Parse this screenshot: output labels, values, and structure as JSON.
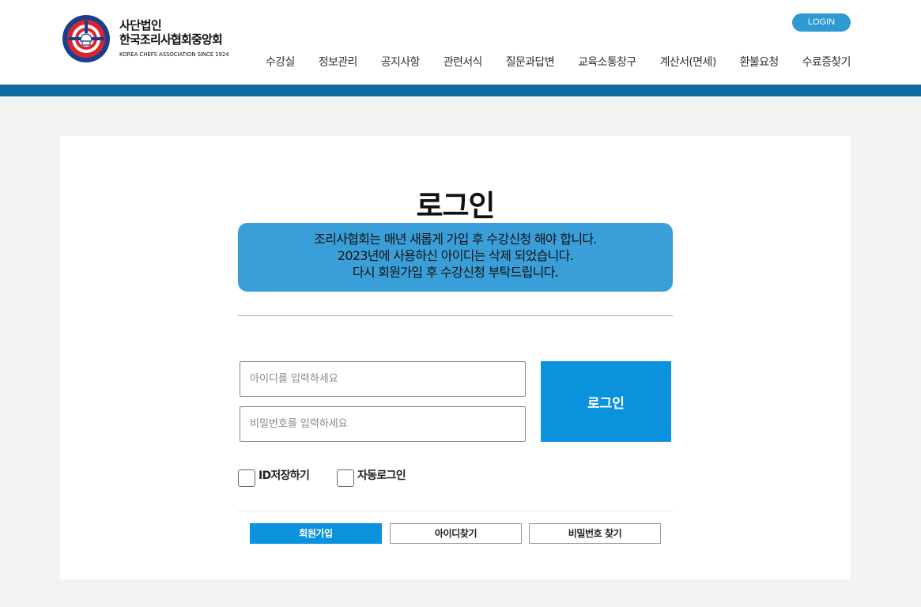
{
  "header": {
    "logo": {
      "line1": "사단법인",
      "line2": "한국조리사협회중앙회",
      "line3": "KOREA CHEFS ASSOCIATION SINCE 1924"
    },
    "login_label": "LOGIN",
    "nav": [
      {
        "label": "수강실"
      },
      {
        "label": "정보관리"
      },
      {
        "label": "공지사항"
      },
      {
        "label": "관련서식"
      },
      {
        "label": "질문과답변"
      },
      {
        "label": "교육소통창구"
      },
      {
        "label": "계산서(면세)"
      },
      {
        "label": "환불요청"
      },
      {
        "label": "수료증찾기"
      }
    ]
  },
  "login": {
    "title": "로그인",
    "notice": [
      "조리사협회는 매년 새롭게 가입 후 수강신청 해야 합니다.",
      "2023년에 사용하신 아이디는 삭제 되었습니다.",
      "다시 회원가입 후 수강신청 부탁드립니다."
    ],
    "id_placeholder": "아이디를 입력하세요",
    "pw_placeholder": "비밀번호를 입력하세요",
    "submit_label": "로그인",
    "save_id_label": "ID저장하기",
    "auto_login_label": "자동로그인",
    "join_label": "회원가입",
    "find_id_label": "아이디찾기",
    "find_pw_label": "비밀번호 찾기"
  },
  "colors": {
    "accent": "#0b92dd",
    "bar": "#126aa5",
    "notice_bg": "#3a9fd8"
  }
}
